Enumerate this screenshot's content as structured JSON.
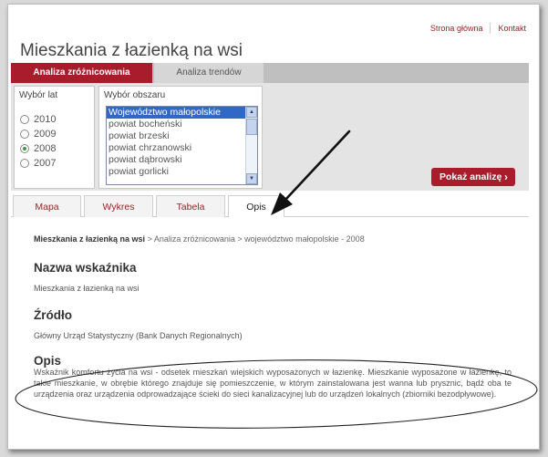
{
  "header": {
    "links": [
      "Strona główna",
      "Kontakt"
    ],
    "title": "Mieszkania z łazienką na wsi"
  },
  "top_tabs": [
    "Analiza zróżnicowania",
    "Analiza trendów"
  ],
  "year_selector": {
    "label": "Wybór lat",
    "options": [
      "2010",
      "2009",
      "2008",
      "2007"
    ],
    "selected": "2008"
  },
  "area_selector": {
    "label": "Wybór obszaru",
    "items": [
      "Województwo małopolskie",
      "powiat bocheński",
      "powiat brzeski",
      "powiat chrzanowski",
      "powiat dąbrowski",
      "powiat gorlicki"
    ],
    "selected": "Województwo małopolskie"
  },
  "show_button": {
    "label": "Pokaż analizę",
    "chevron": "›"
  },
  "lower_tabs": [
    "Mapa",
    "Wykres",
    "Tabela",
    "Opis"
  ],
  "active_lower_tab": "Opis",
  "breadcrumb": {
    "first": "Mieszkania z łazienką na wsi",
    "rest": " > Analiza zróżnicowania > województwo małopolskie - 2008"
  },
  "content": {
    "indicator_heading": "Nazwa wskaźnika",
    "indicator_text": "Mieszkania z łazienką na wsi",
    "source_heading": "Źródło",
    "source_text": "Główny Urząd Statystyczny (Bank Danych Regionalnych)",
    "description_heading": "Opis",
    "description_text": "Wskaźnik komfortu życia na wsi - odsetek mieszkań wiejskich wyposażonych w łazienkę. Mieszkanie wyposażone w łazienkę, to takie mieszkanie, w obrębie którego znajduje się pomieszczenie, w którym zainstalowana jest wanna lub prysznic, bądź oba te urządzenia oraz urządzenia odprowadzające ścieki do sieci kanalizacyjnej lub do urządzeń lokalnych (zbiorniki bezodpływowe)."
  },
  "colors": {
    "accent": "#a81c2b",
    "list_selection": "#3168c5"
  }
}
